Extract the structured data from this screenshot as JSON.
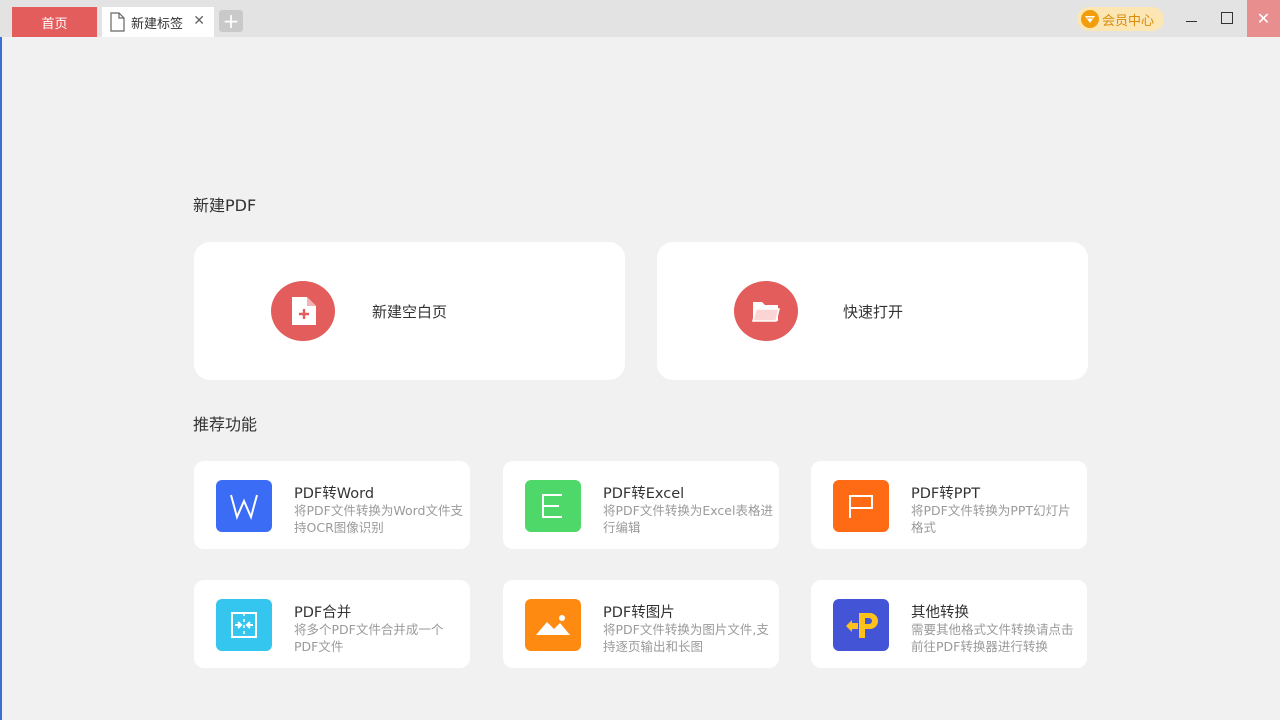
{
  "tabs": {
    "home_label": "首页",
    "new_tab_label": "新建标签",
    "close_symbol": "✕",
    "add_symbol": "+"
  },
  "header": {
    "vip_label": "会员中心",
    "close_symbol": "✕"
  },
  "sections": {
    "new_pdf_title": "新建PDF",
    "recommend_title": "推荐功能"
  },
  "new_pdf": {
    "blank_page_label": "新建空白页",
    "quick_open_label": "快速打开"
  },
  "features": [
    {
      "title": "PDF转Word",
      "desc": "将PDF文件转换为Word文件支持OCR图像识别",
      "icon": "word-icon",
      "color": "#3b6cf6"
    },
    {
      "title": "PDF转Excel",
      "desc": "将PDF文件转换为Excel表格进行编辑",
      "icon": "excel-icon",
      "color": "#4fd86a"
    },
    {
      "title": "PDF转PPT",
      "desc": "将PDF文件转换为PPT幻灯片格式",
      "icon": "ppt-icon",
      "color": "#ff6b14"
    },
    {
      "title": "PDF合并",
      "desc": "将多个PDF文件合并成一个PDF文件",
      "icon": "merge-icon",
      "color": "#35c6f0"
    },
    {
      "title": "PDF转图片",
      "desc": "将PDF文件转换为图片文件,支持逐页输出和长图",
      "icon": "image-icon",
      "color": "#ff8a12"
    },
    {
      "title": "其他转换",
      "desc": "需要其他格式文件转换请点击前往PDF转换器进行转换",
      "icon": "other-convert-icon",
      "color": "#4354d6"
    }
  ],
  "colors": {
    "accent": "#e35d5d",
    "background": "#f1f1f1",
    "vip_bg": "#fbe6b4",
    "vip_text": "#d98c0a"
  }
}
